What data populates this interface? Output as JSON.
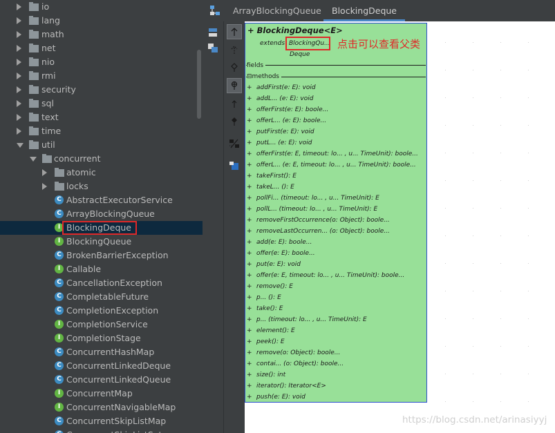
{
  "tree": {
    "items": [
      {
        "label": "io",
        "kind": "folder",
        "indent": 0,
        "expanded": false
      },
      {
        "label": "lang",
        "kind": "folder",
        "indent": 0,
        "expanded": false
      },
      {
        "label": "math",
        "kind": "folder",
        "indent": 0,
        "expanded": false
      },
      {
        "label": "net",
        "kind": "folder",
        "indent": 0,
        "expanded": false
      },
      {
        "label": "nio",
        "kind": "folder",
        "indent": 0,
        "expanded": false
      },
      {
        "label": "rmi",
        "kind": "folder",
        "indent": 0,
        "expanded": false
      },
      {
        "label": "security",
        "kind": "folder",
        "indent": 0,
        "expanded": false
      },
      {
        "label": "sql",
        "kind": "folder",
        "indent": 0,
        "expanded": false
      },
      {
        "label": "text",
        "kind": "folder",
        "indent": 0,
        "expanded": false
      },
      {
        "label": "time",
        "kind": "folder",
        "indent": 0,
        "expanded": false
      },
      {
        "label": "util",
        "kind": "folder",
        "indent": 0,
        "expanded": true
      },
      {
        "label": "concurrent",
        "kind": "folder",
        "indent": 1,
        "expanded": true
      },
      {
        "label": "atomic",
        "kind": "folder",
        "indent": 2,
        "expanded": false
      },
      {
        "label": "locks",
        "kind": "folder",
        "indent": 2,
        "expanded": false
      },
      {
        "label": "AbstractExecutorService",
        "kind": "class",
        "indent": 2
      },
      {
        "label": "ArrayBlockingQueue",
        "kind": "class",
        "indent": 2
      },
      {
        "label": "BlockingDeque",
        "kind": "interface",
        "indent": 2,
        "selected": true
      },
      {
        "label": "BlockingQueue",
        "kind": "interface",
        "indent": 2
      },
      {
        "label": "BrokenBarrierException",
        "kind": "class",
        "indent": 2
      },
      {
        "label": "Callable",
        "kind": "interface",
        "indent": 2
      },
      {
        "label": "CancellationException",
        "kind": "class",
        "indent": 2
      },
      {
        "label": "CompletableFuture",
        "kind": "class",
        "indent": 2
      },
      {
        "label": "CompletionException",
        "kind": "class",
        "indent": 2
      },
      {
        "label": "CompletionService",
        "kind": "interface",
        "indent": 2
      },
      {
        "label": "CompletionStage",
        "kind": "interface",
        "indent": 2
      },
      {
        "label": "ConcurrentHashMap",
        "kind": "class",
        "indent": 2
      },
      {
        "label": "ConcurrentLinkedDeque",
        "kind": "class",
        "indent": 2
      },
      {
        "label": "ConcurrentLinkedQueue",
        "kind": "class",
        "indent": 2
      },
      {
        "label": "ConcurrentMap",
        "kind": "interface",
        "indent": 2
      },
      {
        "label": "ConcurrentNavigableMap",
        "kind": "interface",
        "indent": 2
      },
      {
        "label": "ConcurrentSkipListMap",
        "kind": "class",
        "indent": 2
      },
      {
        "label": "ConcurrentSkipListSet",
        "kind": "class",
        "indent": 2
      }
    ]
  },
  "tabs": [
    {
      "label": "ArrayBlockingQueue",
      "active": false
    },
    {
      "label": "BlockingDeque",
      "active": true
    }
  ],
  "uml": {
    "title": "+ BlockingDeque<E>",
    "extends_label": "extends",
    "parents": [
      "BlockingQu...",
      "Deque"
    ],
    "fields_label": "fields",
    "methods_label": "methods",
    "methods": [
      "addFirst(e: E): void",
      "addL...  (e: E): void",
      "offerFirst(e: E): boole...",
      "offerL...  (e: E): boole...",
      "putFirst(e: E): void",
      "putL...  (e: E): void",
      "offerFirst(e: E,  timeout: lo... ,  u...  TimeUnit): boole...",
      "offerL...  (e: E,  timeout: lo... ,  u...  TimeUnit): boole...",
      "takeFirst(): E",
      "takeL...  (): E",
      "pollFi...  (timeout: lo... ,  u...  TimeUnit): E",
      "pollL...  (timeout: lo... ,  u...  TimeUnit): E",
      "removeFirstOccurrence(o: Object): boole...",
      "removeLastOccurren... (o: Object): boole...",
      "add(e: E): boole...",
      "offer(e: E): boole...",
      "put(e: E): void",
      "offer(e: E,  timeout: lo... ,  u...  TimeUnit): boole...",
      "remove(): E",
      "p... (): E",
      "take(): E",
      "p...  (timeout: lo... ,  u...  TimeUnit): E",
      "element(): E",
      "peek(): E",
      "remove(o: Object): boole...",
      "contai...  (o: Object): boole...",
      "size(): int",
      "iterator(): Iterator<E>",
      "push(e: E): void"
    ]
  },
  "annotation": "点击可以查看父类",
  "watermark": "https://blog.csdn.net/arinasiyyj",
  "colors": {
    "node_fill": "#98e098",
    "node_border": "#2c4fd0",
    "highlight": "#e02828",
    "selection": "#0d293e"
  }
}
